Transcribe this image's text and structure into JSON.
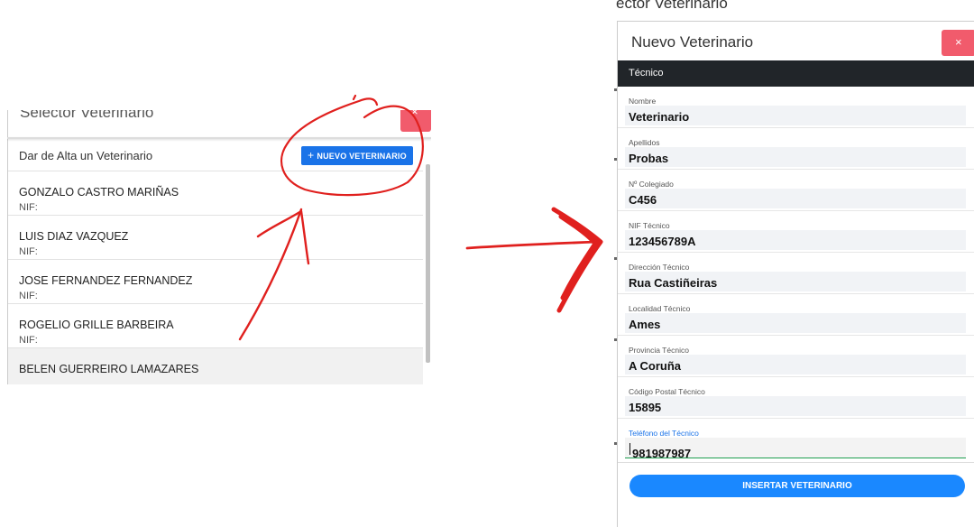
{
  "left": {
    "title": "Selector Veterinario",
    "add_label": "Dar de Alta un Veterinario",
    "add_button": "NUEVO VETERINARIO",
    "add_icon": "+",
    "close_icon": "×",
    "items": [
      {
        "name": "GONZALO CASTRO MARIÑAS",
        "nif": "NIF:"
      },
      {
        "name": "LUIS DIAZ VAZQUEZ",
        "nif": "NIF:"
      },
      {
        "name": "JOSE FERNANDEZ FERNANDEZ",
        "nif": "NIF:"
      },
      {
        "name": "ROGELIO GRILLE BARBEIRA",
        "nif": "NIF:"
      },
      {
        "name": "BELEN GUERREIRO LAMAZARES",
        "nif": ""
      }
    ]
  },
  "right": {
    "background_heading": "ector Veterinario",
    "title": "Nuevo Veterinario",
    "close_icon": "×",
    "section": "Técnico",
    "fields": [
      {
        "label": "Nombre",
        "value": "Veterinario"
      },
      {
        "label": "Apellidos",
        "value": "Probas"
      },
      {
        "label": "Nº Colegiado",
        "value": "C456"
      },
      {
        "label": "NIF Técnico",
        "value": "123456789A"
      },
      {
        "label": "Dirección Técnico",
        "value": "Rua Castiñeiras"
      },
      {
        "label": "Localidad Técnico",
        "value": "Ames"
      },
      {
        "label": "Provincia Técnico",
        "value": "A Coruña"
      },
      {
        "label": "Código Postal Técnico",
        "value": "15895"
      },
      {
        "label": "Teléfono del Técnico",
        "value": "981987987"
      }
    ],
    "submit_button": "INSERTAR VETERINARIO"
  },
  "colors": {
    "primary": "#1a73e8",
    "danger": "#f15b6c",
    "section_bar": "#212529",
    "annotation": "#e0201e"
  }
}
